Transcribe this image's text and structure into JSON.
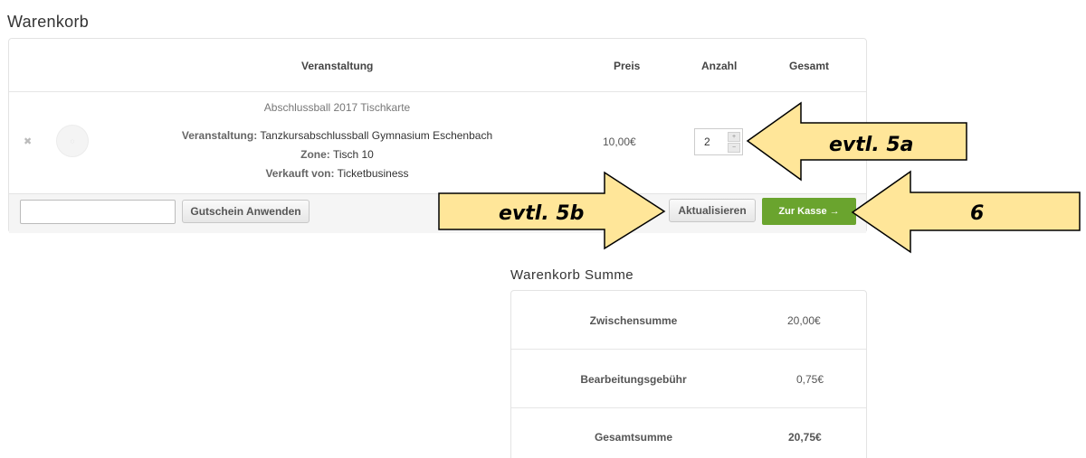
{
  "page_title": "Warenkorb",
  "cart": {
    "headers": {
      "event": "Veranstaltung",
      "price": "Preis",
      "quantity": "Anzahl",
      "total": "Gesamt"
    },
    "item": {
      "remove_icon": "remove-x-icon",
      "name": "Abschlussball 2017 Tischkarte",
      "event_label": "Veranstaltung:",
      "event_value": "Tanzkursabschlussball Gymnasium Eschenbach",
      "zone_label": "Zone:",
      "zone_value": "Tisch 10",
      "seller_label": "Verkauft von:",
      "seller_value": "Ticketbusiness",
      "price": "10,00€",
      "quantity": "2"
    },
    "coupon_placeholder": "",
    "coupon_button": "Gutschein Anwenden",
    "update_button": "Aktualisieren",
    "checkout_button": "Zur Kasse →"
  },
  "summary": {
    "title": "Warenkorb Summe",
    "subtotal_label": "Zwischensumme",
    "subtotal_value": "20,00€",
    "fee_label": "Bearbeitungsgebühr",
    "fee_value": "0,75€",
    "total_label": "Gesamtsumme",
    "total_value": "20,75€"
  },
  "annotations": {
    "arrow_5a": "evtl. 5a",
    "arrow_5b": "evtl. 5b",
    "arrow_6": "6",
    "arrow_color": "#FFE699"
  }
}
